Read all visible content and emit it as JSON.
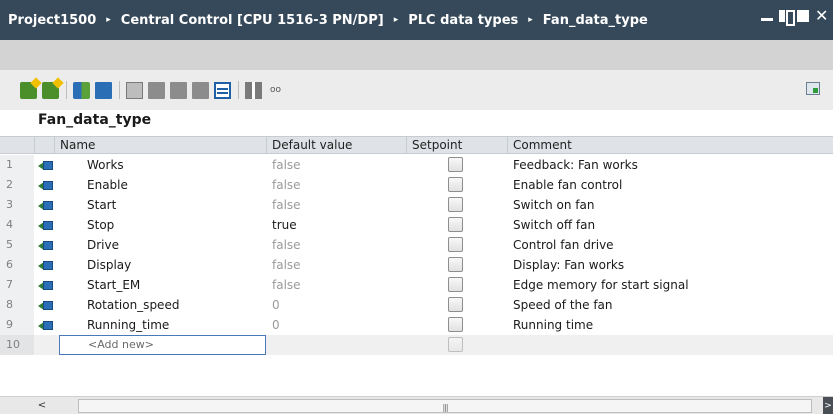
{
  "titlebar": {
    "breadcrumbs": [
      "Project1500",
      "Central Control [CPU 1516-3 PN/DP]",
      "PLC data types",
      "Fan_data_type"
    ],
    "separator": "▸"
  },
  "toolbar": {
    "icons": [
      "insert-row-icon",
      "add-row-icon",
      "blue-green-icon",
      "edit-icon",
      "copy-icon",
      "move-down-icon",
      "move-up-icon",
      "export-icon",
      "table-view-icon",
      "columns-icon",
      "monitor-icon"
    ]
  },
  "table": {
    "title": "Fan_data_type",
    "columns": [
      "Name",
      "Default value",
      "Setpoint",
      "Comment"
    ],
    "rows": [
      {
        "num": "1",
        "name": "Works",
        "default": "false",
        "comment": "Feedback: Fan works"
      },
      {
        "num": "2",
        "name": "Enable",
        "default": "false",
        "comment": "Enable fan control"
      },
      {
        "num": "3",
        "name": "Start",
        "default": "false",
        "comment": "Switch on fan"
      },
      {
        "num": "4",
        "name": "Stop",
        "default": "true",
        "comment": "Switch off fan"
      },
      {
        "num": "5",
        "name": "Drive",
        "default": "false",
        "comment": "Control fan drive"
      },
      {
        "num": "6",
        "name": "Display",
        "default": "false",
        "comment": "Display: Fan works"
      },
      {
        "num": "7",
        "name": "Start_EM",
        "default": "false",
        "comment": "Edge memory for start signal"
      },
      {
        "num": "8",
        "name": "Rotation_speed",
        "default": "0",
        "comment": "Speed of the fan"
      },
      {
        "num": "9",
        "name": "Running_time",
        "default": "0",
        "comment": "Running time"
      }
    ],
    "add_new": {
      "num": "10",
      "placeholder": "<Add new>"
    }
  },
  "scrollbar": {
    "left_arrow": "<",
    "right_arrow": ">",
    "grip": "|||"
  }
}
